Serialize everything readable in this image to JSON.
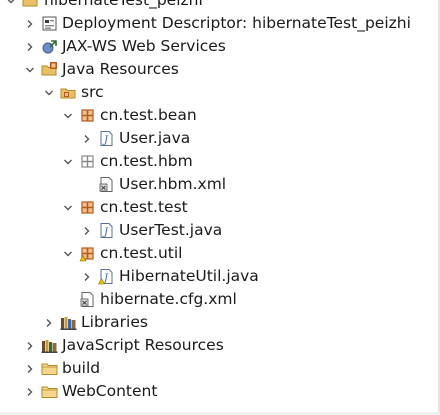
{
  "tree": {
    "project": {
      "label": "hibernateTest_peizhi",
      "icon": "java-project-icon",
      "expanded": true
    },
    "deployment_descriptor": {
      "label": "Deployment Descriptor: hibernateTest_peizhi",
      "icon": "deployment-descriptor-icon"
    },
    "jaxws": {
      "label": "JAX-WS Web Services",
      "icon": "web-services-icon"
    },
    "java_resources": {
      "label": "Java Resources",
      "icon": "java-resources-icon",
      "expanded": true
    },
    "src": {
      "label": "src",
      "icon": "source-folder-icon",
      "expanded": true
    },
    "pkg_bean": {
      "label": "cn.test.bean",
      "icon": "package-icon",
      "expanded": true
    },
    "user_java": {
      "label": "User.java",
      "icon": "java-file-icon"
    },
    "pkg_hbm": {
      "label": "cn.test.hbm",
      "icon": "package-icon",
      "expanded": true
    },
    "user_hbm_xml": {
      "label": "User.hbm.xml",
      "icon": "xml-file-icon"
    },
    "pkg_test": {
      "label": "cn.test.test",
      "icon": "package-icon",
      "expanded": true
    },
    "usertest_java": {
      "label": "UserTest.java",
      "icon": "java-file-icon"
    },
    "pkg_util": {
      "label": "cn.test.util",
      "icon": "package-icon",
      "expanded": true
    },
    "hibernateutil_java": {
      "label": "HibernateUtil.java",
      "icon": "java-file-warning-icon"
    },
    "hibernate_cfg_xml": {
      "label": "hibernate.cfg.xml",
      "icon": "xml-file-icon"
    },
    "libraries": {
      "label": "Libraries",
      "icon": "libraries-icon"
    },
    "js_resources": {
      "label": "JavaScript Resources",
      "icon": "javascript-resources-icon"
    },
    "build": {
      "label": "build",
      "icon": "folder-icon"
    },
    "webcontent": {
      "label": "WebContent",
      "icon": "folder-icon"
    }
  },
  "colors": {
    "folder": "#e9c165",
    "package": "#b65a1d",
    "java": "#3a67b0",
    "arrow": "#555555"
  }
}
